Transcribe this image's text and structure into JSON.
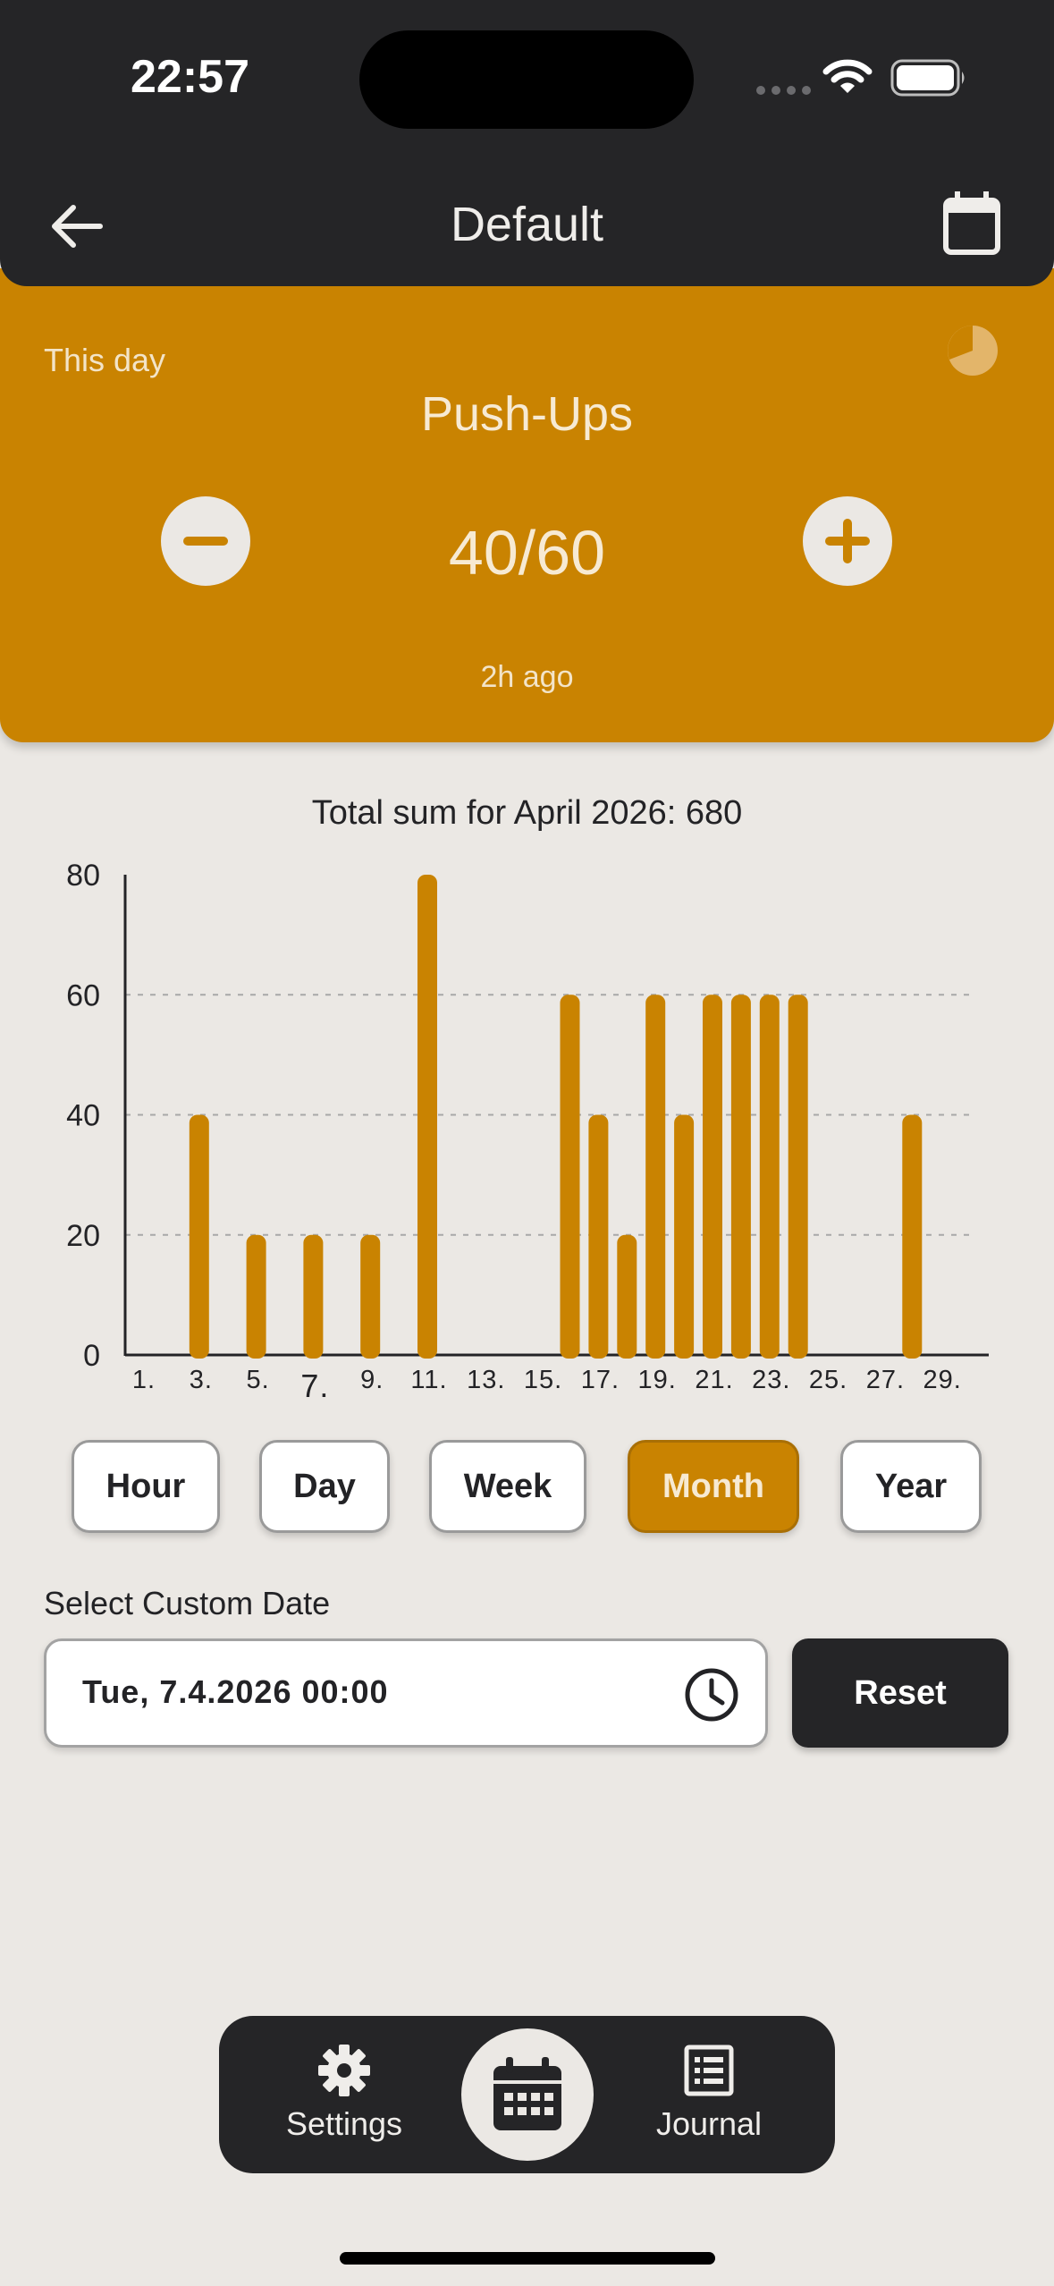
{
  "status_bar": {
    "time": "22:57"
  },
  "app_bar": {
    "title": "Default"
  },
  "habit": {
    "period": "This day",
    "name": "Push-Ups",
    "count": "40/60",
    "last_update": "2h ago"
  },
  "chart": {
    "title": "Total sum for April 2026: 680"
  },
  "chart_data": {
    "type": "bar",
    "title": "Total sum for April 2026: 680",
    "xlabel": "",
    "ylabel": "",
    "ylim": [
      0,
      80
    ],
    "yticks": [
      0,
      20,
      40,
      60,
      80
    ],
    "x_tick_labels": [
      "1.",
      "3.",
      "5.",
      "7.",
      "9.",
      "11.",
      "13.",
      "15.",
      "17.",
      "19.",
      "21.",
      "23.",
      "25.",
      "27.",
      "29."
    ],
    "highlighted_tick": "7.",
    "grid": "horizontal dashed at 20, 40, 60",
    "categories": [
      1,
      2,
      3,
      4,
      5,
      6,
      7,
      8,
      9,
      10,
      11,
      12,
      13,
      14,
      15,
      16,
      17,
      18,
      19,
      20,
      21,
      22,
      23,
      24,
      25,
      26,
      27,
      28,
      29,
      30
    ],
    "values": [
      0,
      0,
      40,
      0,
      20,
      0,
      20,
      0,
      20,
      0,
      80,
      0,
      0,
      0,
      0,
      60,
      40,
      20,
      60,
      40,
      60,
      60,
      60,
      60,
      0,
      0,
      0,
      40,
      0,
      0
    ],
    "color": "#c98301"
  },
  "range_tabs": [
    {
      "label": "Hour",
      "active": false
    },
    {
      "label": "Day",
      "active": false
    },
    {
      "label": "Week",
      "active": false
    },
    {
      "label": "Month",
      "active": true
    },
    {
      "label": "Year",
      "active": false
    }
  ],
  "custom_date": {
    "label": "Select Custom Date",
    "value": "Tue, 7.4.2026 00:00",
    "reset_label": "Reset"
  },
  "bottom_nav": {
    "settings_label": "Settings",
    "journal_label": "Journal"
  },
  "colors": {
    "accent": "#c98301",
    "dark": "#252527",
    "background": "#ebe8e4"
  }
}
